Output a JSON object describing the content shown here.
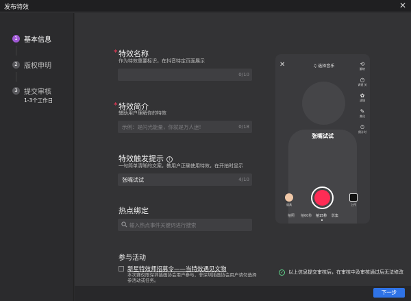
{
  "window": {
    "title": "发布特效",
    "close": "✕"
  },
  "sidebar": {
    "steps": [
      {
        "num": "1",
        "label": "基本信息"
      },
      {
        "num": "2",
        "label": "版权申明"
      },
      {
        "num": "3",
        "label": "提交审核"
      }
    ],
    "step3_sub": "1-3个工作日"
  },
  "form": {
    "name": {
      "title": "特效名称",
      "required": "*",
      "desc": "作为特效重要标识，在抖音特定页面展示",
      "placeholder": "",
      "count": "0/10"
    },
    "intro": {
      "title": "特效简介",
      "required": "*",
      "desc": "辅助用户理解你的特效",
      "placeholder": "示例：是闪光能量，你就是万人迷!",
      "count": "0/18"
    },
    "trigger": {
      "title": "特效触发提示",
      "info": "i",
      "desc": "一句简单清晰的文案，教用户正确使用特效，在开拍时显示",
      "value": "张嘴试试",
      "count": "4/10"
    },
    "hotspot": {
      "title": "热点绑定",
      "search_icon": "search-icon",
      "placeholder": "输入热点事件关键词进行搜索"
    },
    "activity": {
      "title": "参与活动",
      "item_title": "新星特效师招募令——当特效遇见文物",
      "item_desc": "本次赛仅限深圳插画协会用户参与，非深圳插画协会用户请勿选择参活动或任务。"
    }
  },
  "preview": {
    "close": "✕",
    "music": "♫ 选择音乐",
    "effect_name": "张嘴试试",
    "tools": [
      {
        "icon": "⟲",
        "label": "翻转"
      },
      {
        "icon": "◷",
        "label": "调速 关"
      },
      {
        "icon": "✿",
        "label": "滤镜"
      },
      {
        "icon": "✎",
        "label": "美化"
      },
      {
        "icon": "⏱",
        "label": "倒计时"
      }
    ],
    "left_btn": "道具",
    "right_btn": "上传",
    "modes": [
      "拍照",
      "拍60秒",
      "拍15秒",
      "影集"
    ],
    "active_mode": "拍15秒"
  },
  "notice": {
    "icon": "✓",
    "text": "以上信息提交审核后，在审核中及审核通过后无法修改"
  },
  "footer": {
    "next": "下一步"
  }
}
